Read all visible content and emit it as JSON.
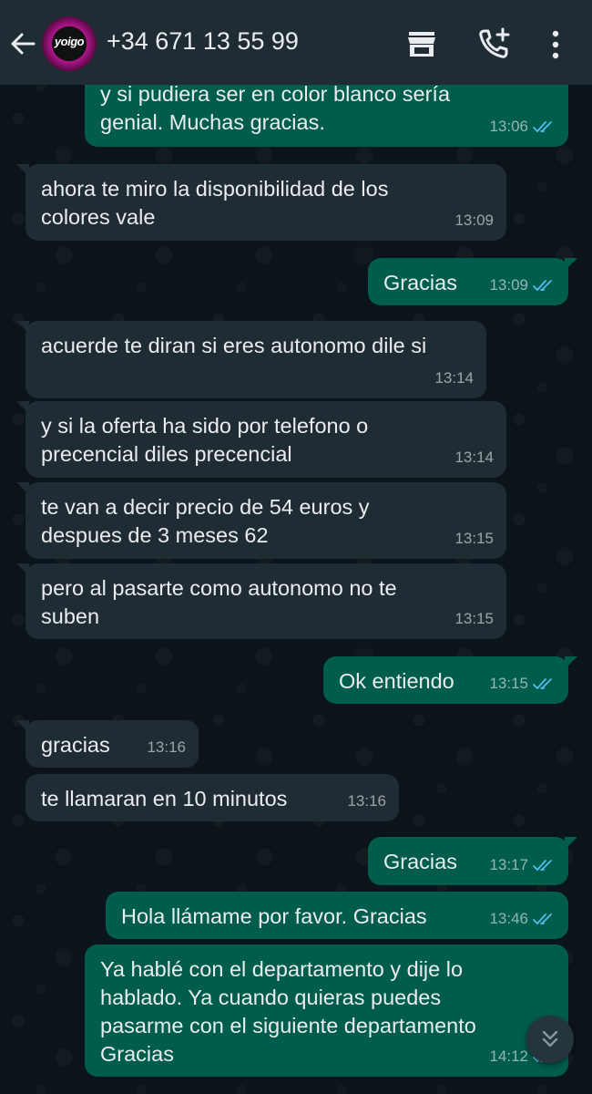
{
  "header": {
    "avatar_text": "yoigo",
    "contact": "+34 671 13 55 99"
  },
  "messages": [
    {
      "dir": "out",
      "lines": "y si pudiera ser en color blanco sería\ngenial. Muchas gracias.",
      "time": "13:06",
      "status": "read"
    },
    {
      "dir": "in",
      "lines": "ahora te miro la disponibilidad de los\ncolores vale",
      "time": "13:09"
    },
    {
      "dir": "out",
      "lines": "Gracias",
      "time": "13:09",
      "status": "read"
    },
    {
      "dir": "in",
      "lines": "acuerde te diran si eres autonomo dile si",
      "time": "13:14"
    },
    {
      "dir": "in",
      "lines": "y si la oferta ha sido por telefono o\nprecencial diles precencial",
      "time": "13:14"
    },
    {
      "dir": "in",
      "lines": "te van a decir precio de 54 euros y\ndespues de 3 meses 62",
      "time": "13:15"
    },
    {
      "dir": "in",
      "lines": "pero al pasarte como autonomo no te\nsuben",
      "time": "13:15"
    },
    {
      "dir": "out",
      "lines": "Ok entiendo",
      "time": "13:15",
      "status": "read"
    },
    {
      "dir": "in",
      "lines": "gracias",
      "time": "13:16"
    },
    {
      "dir": "in",
      "lines": "te llamaran en 10 minutos",
      "time": "13:16"
    },
    {
      "dir": "out",
      "lines": "Gracias",
      "time": "13:17",
      "status": "read"
    },
    {
      "dir": "out",
      "lines": "Hola llámame por favor. Gracias",
      "time": "13:46",
      "status": "read"
    },
    {
      "dir": "out",
      "lines": "Ya hablé con el departamento y dije lo\nhablado. Ya cuando quieras puedes\npasarme con el siguiente departamento\nGracias",
      "time": "14:12",
      "status": "read"
    }
  ],
  "colors": {
    "header_bg": "#1f2c34",
    "incoming_bubble": "#202c33",
    "outgoing_bubble": "#005c4b",
    "read_ticks": "#53bdeb"
  },
  "icons": {
    "back": "arrow-left-icon",
    "shop": "shop-icon",
    "add_call": "add-call-icon",
    "menu": "more-vertical-icon",
    "scroll": "chevron-double-down-icon"
  }
}
